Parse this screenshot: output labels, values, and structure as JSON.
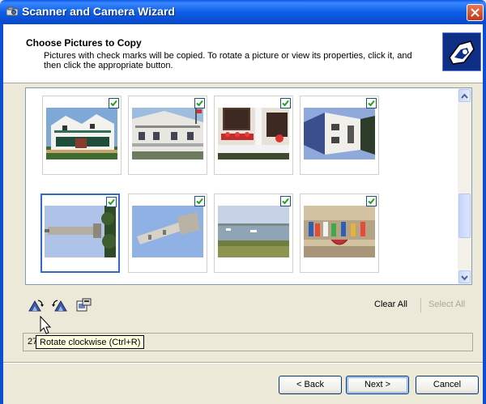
{
  "window": {
    "title": "Scanner and Camera Wizard"
  },
  "header": {
    "title": "Choose Pictures to Copy",
    "description": "Pictures with check marks will be copied. To rotate a picture or view its properties, click it, and then click the appropriate button.",
    "icon": "camera-wizard-icon"
  },
  "pictures": [
    {
      "name": "victorian-house",
      "checked": true,
      "selected": false
    },
    {
      "name": "white-house-porch",
      "checked": true,
      "selected": false
    },
    {
      "name": "red-window-boxes",
      "checked": true,
      "selected": false
    },
    {
      "name": "rotated-house",
      "checked": true,
      "selected": false
    },
    {
      "name": "rotated-tower",
      "checked": true,
      "selected": true
    },
    {
      "name": "tilted-tower",
      "checked": true,
      "selected": false
    },
    {
      "name": "harbor-view",
      "checked": true,
      "selected": false
    },
    {
      "name": "colorful-storefront",
      "checked": true,
      "selected": false
    }
  ],
  "toolbar": {
    "rotate_clockwise_icon": "rotate-clockwise-icon",
    "rotate_counterclockwise_icon": "rotate-counterclockwise-icon",
    "properties_icon": "properties-icon",
    "clear_all_label": "Clear All",
    "select_all_label": "Select All"
  },
  "status": {
    "text": "27"
  },
  "tooltip": {
    "text": "Rotate clockwise (Ctrl+R)"
  },
  "buttons": {
    "back_label": "< Back",
    "next_label": "Next >",
    "cancel_label": "Cancel"
  },
  "colors": {
    "titlebar": "#0A5BEA",
    "selection": "#316AC5",
    "checkmark": "#21A121",
    "dialog_bg": "#ECE9D8"
  }
}
